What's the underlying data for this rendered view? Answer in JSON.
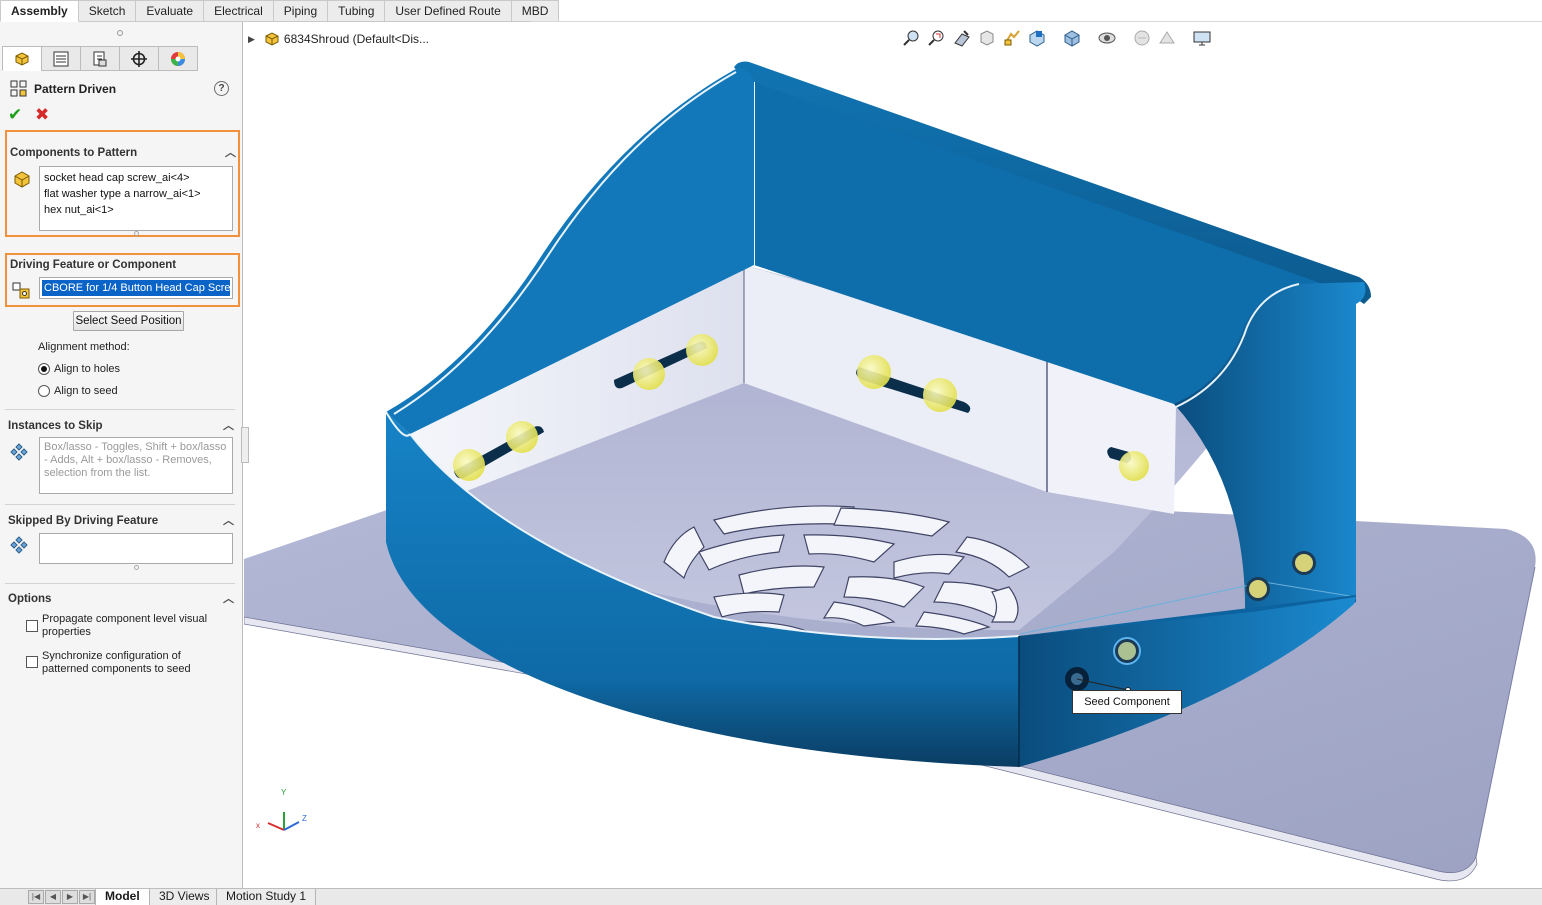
{
  "command_tabs": [
    "Assembly",
    "Sketch",
    "Evaluate",
    "Electrical",
    "Piping",
    "Tubing",
    "User Defined Route",
    "MBD"
  ],
  "property_manager": {
    "title": "Pattern Driven",
    "help": "?",
    "ok_glyph": "✔",
    "cancel_glyph": "✖",
    "components_to_pattern": {
      "heading": "Components to Pattern",
      "items": [
        "socket head cap screw_ai<4>",
        "flat washer type a narrow_ai<1>",
        "hex nut_ai<1>"
      ]
    },
    "driving_feature": {
      "heading": "Driving Feature or Component",
      "value": "CBORE for 1/4 Button Head Cap Scre"
    },
    "select_seed_button": "Select Seed Position",
    "alignment": {
      "label": "Alignment method:",
      "options": [
        "Align to holes",
        "Align to seed"
      ],
      "selected": "Align to holes"
    },
    "instances_to_skip": {
      "heading": "Instances to Skip",
      "placeholder": "Box/lasso - Toggles, Shift + box/lasso - Adds, Alt + box/lasso - Removes, selection from the list."
    },
    "skipped_by_driving": {
      "heading": "Skipped By Driving Feature"
    },
    "options": {
      "heading": "Options",
      "propagate": "Propagate component level visual properties",
      "synchronize": "Synchronize configuration of patterned components to seed"
    }
  },
  "tree": {
    "assembly": "6834Shroud  (Default<Dis..."
  },
  "viewport": {
    "tooltip": "Seed Component",
    "colors": {
      "shroud": "#0f7fc4",
      "plate": "#b8bdd8",
      "hardware": "#f3f07a",
      "highlight": "#f2913b"
    },
    "triad_labels": {
      "x": "x",
      "y": "Y",
      "z": "Z"
    }
  },
  "bottom_tabs": [
    "Model",
    "3D Views",
    "Motion Study 1"
  ],
  "active_bottom_tab": "Model"
}
